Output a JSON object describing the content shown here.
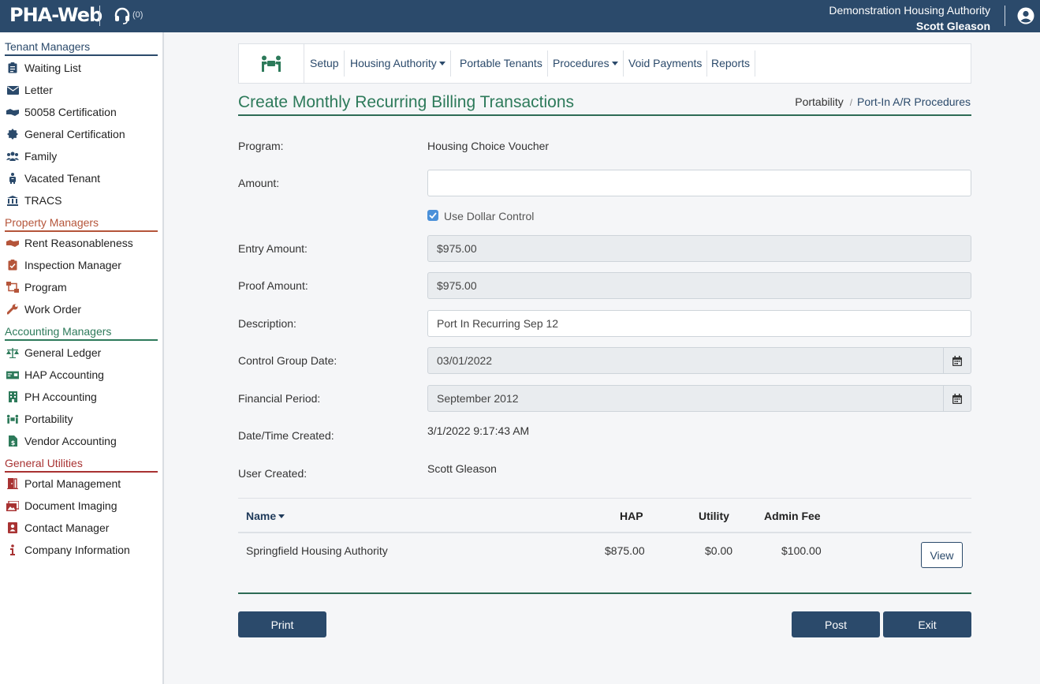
{
  "app": {
    "logo": "PHA-Web",
    "support_count": "(0)",
    "org_name": "Demonstration Housing Authority",
    "user_name": "Scott Gleason"
  },
  "sidebar": {
    "sections": [
      {
        "title": "Tenant Managers",
        "color": "#2b4a6b",
        "items": [
          {
            "label": "Waiting List",
            "icon": "clipboard-list-icon"
          },
          {
            "label": "Letter",
            "icon": "envelope-icon"
          },
          {
            "label": "50058 Certification",
            "icon": "handshake-icon"
          },
          {
            "label": "General Certification",
            "icon": "certificate-icon"
          },
          {
            "label": "Family",
            "icon": "users-icon"
          },
          {
            "label": "Vacated Tenant",
            "icon": "person-luggage-icon"
          },
          {
            "label": "TRACS",
            "icon": "bank-icon"
          }
        ]
      },
      {
        "title": "Property Managers",
        "color": "#b5553a",
        "items": [
          {
            "label": "Rent Reasonableness",
            "icon": "handshake-icon"
          },
          {
            "label": "Inspection Manager",
            "icon": "clipboard-check-icon"
          },
          {
            "label": "Program",
            "icon": "sitemap-icon"
          },
          {
            "label": "Work Order",
            "icon": "wrench-icon"
          }
        ]
      },
      {
        "title": "Accounting Managers",
        "color": "#2d7a5a",
        "items": [
          {
            "label": "General Ledger",
            "icon": "balance-scale-icon"
          },
          {
            "label": "HAP Accounting",
            "icon": "money-bill-icon"
          },
          {
            "label": "PH Accounting",
            "icon": "building-icon"
          },
          {
            "label": "Portability",
            "icon": "people-carry-icon"
          },
          {
            "label": "Vendor Accounting",
            "icon": "file-invoice-dollar-icon"
          }
        ]
      },
      {
        "title": "General Utilities",
        "color": "#a83232",
        "items": [
          {
            "label": "Portal Management",
            "icon": "door-open-icon"
          },
          {
            "label": "Document Imaging",
            "icon": "images-icon"
          },
          {
            "label": "Contact Manager",
            "icon": "address-book-icon"
          },
          {
            "label": "Company Information",
            "icon": "info-icon"
          }
        ]
      }
    ]
  },
  "subnav": {
    "items": [
      {
        "label": "Setup"
      },
      {
        "label": "Housing Authority",
        "dropdown": true
      },
      {
        "label": "Portable Tenants"
      },
      {
        "label": "Procedures",
        "dropdown": true
      },
      {
        "label": "Void Payments"
      },
      {
        "label": "Reports"
      }
    ]
  },
  "page": {
    "title": "Create Monthly Recurring Billing Transactions",
    "breadcrumb": [
      "Portability",
      "Port-In A/R Procedures"
    ]
  },
  "form": {
    "program_label": "Program:",
    "program_value": "Housing Choice Voucher",
    "amount_label": "Amount:",
    "amount_value": "",
    "use_dollar_control_label": "Use Dollar Control",
    "use_dollar_control_checked": true,
    "entry_amount_label": "Entry Amount:",
    "entry_amount_value": "$975.00",
    "proof_amount_label": "Proof Amount:",
    "proof_amount_value": "$975.00",
    "description_label": "Description:",
    "description_value": "Port In Recurring Sep 12",
    "control_group_date_label": "Control Group Date:",
    "control_group_date_value": "03/01/2022",
    "financial_period_label": "Financial Period:",
    "financial_period_value": "September 2012",
    "date_created_label": "Date/Time Created:",
    "date_created_value": "3/1/2022 9:17:43 AM",
    "user_created_label": "User Created:",
    "user_created_value": "Scott Gleason"
  },
  "table": {
    "headers": {
      "name": "Name",
      "hap": "HAP",
      "utility": "Utility",
      "admin_fee": "Admin Fee"
    },
    "rows": [
      {
        "name": "Springfield Housing Authority",
        "hap": "$875.00",
        "utility": "$0.00",
        "admin_fee": "$100.00",
        "action": "View"
      }
    ]
  },
  "buttons": {
    "print": "Print",
    "post": "Post",
    "exit": "Exit"
  },
  "colors": {
    "primary": "#2b4a6b",
    "accent_green": "#2d7a5a",
    "property": "#b5553a",
    "utilities": "#a83232"
  }
}
